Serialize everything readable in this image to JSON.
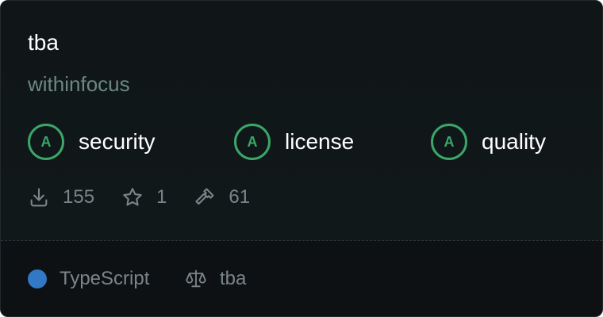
{
  "package": {
    "name": "tba",
    "owner": "withinfocus"
  },
  "grades": [
    {
      "grade": "A",
      "label": "security"
    },
    {
      "grade": "A",
      "label": "license"
    },
    {
      "grade": "A",
      "label": "quality"
    }
  ],
  "stats": {
    "downloads": "155",
    "stars": "1",
    "builds": "61"
  },
  "footer": {
    "language": "TypeScript",
    "language_color": "#3178c6",
    "license": "tba"
  },
  "colors": {
    "grade_green": "#3aa66a",
    "card_bg": "#111618"
  },
  "icons": {
    "downloads": "download-icon",
    "stars": "star-icon",
    "builds": "hammer-icon",
    "license": "scale-icon"
  }
}
